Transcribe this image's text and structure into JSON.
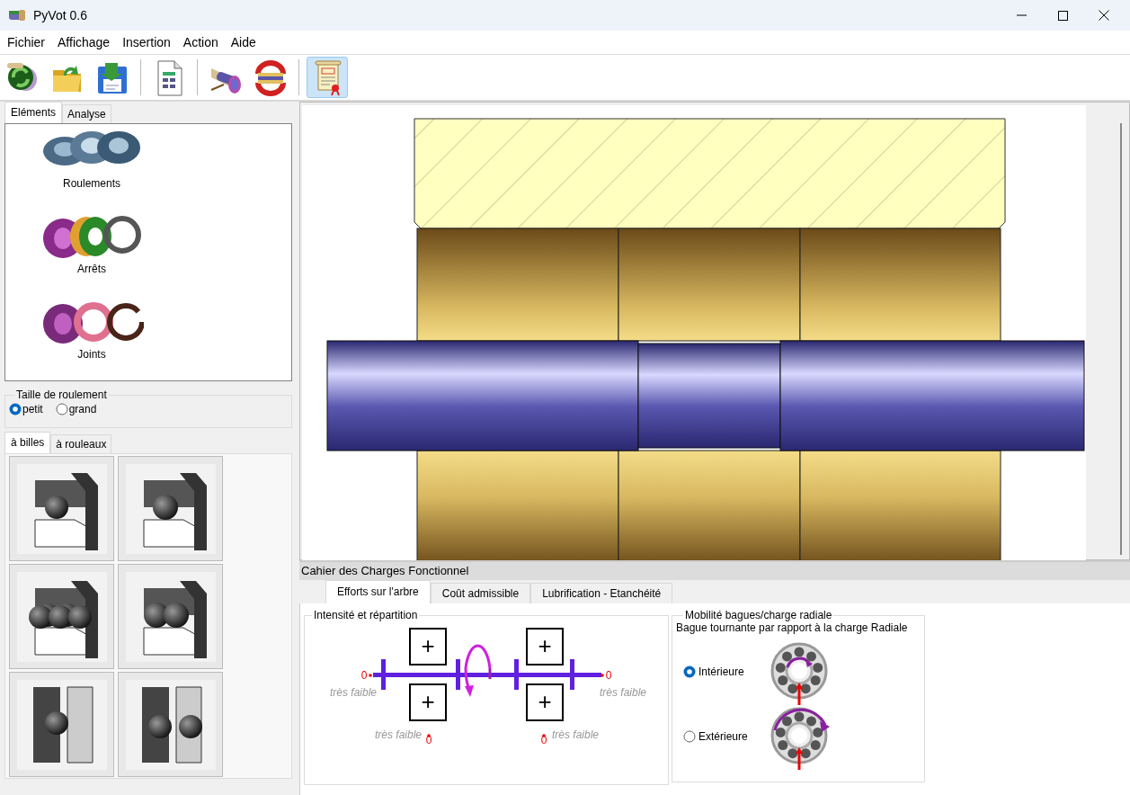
{
  "window": {
    "title": "PyVot 0.6"
  },
  "menu": [
    "Fichier",
    "Affichage",
    "Insertion",
    "Action",
    "Aide"
  ],
  "toolbar": [
    [
      {
        "kind": "new",
        "pressed": false
      },
      {
        "kind": "open",
        "pressed": false
      },
      {
        "kind": "save",
        "pressed": false
      }
    ],
    [
      {
        "kind": "report",
        "pressed": false
      }
    ],
    [
      {
        "kind": "assembly",
        "pressed": false
      },
      {
        "kind": "swap",
        "pressed": false
      }
    ],
    [
      {
        "kind": "cdcf",
        "pressed": true
      }
    ]
  ],
  "left_tabs": [
    {
      "label": "Eléments",
      "selected": true
    },
    {
      "label": "Analyse",
      "selected": false
    }
  ],
  "elements": [
    {
      "label": "Roulements",
      "kind": "bearings"
    },
    {
      "label": "Arrêts",
      "kind": "stops"
    },
    {
      "label": "Joints",
      "kind": "seals"
    }
  ],
  "size_group": {
    "title": "Taille de roulement",
    "options": [
      {
        "label": "petit",
        "selected": true
      },
      {
        "label": "grand",
        "selected": false
      }
    ]
  },
  "bearing_tabs": [
    {
      "label": "à billes",
      "selected": true
    },
    {
      "label": "à rouleaux",
      "selected": false
    }
  ],
  "bearing_types": [
    {
      "kind": "single"
    },
    {
      "kind": "angular"
    },
    {
      "kind": "double"
    },
    {
      "kind": "double-angular"
    },
    {
      "kind": "tall"
    },
    {
      "kind": "tall-double"
    }
  ],
  "cdcf": {
    "title": "Cahier des Charges Fonctionnel",
    "tabs": [
      {
        "label": "Efforts sur l'arbre",
        "selected": true
      },
      {
        "label": "Coût admissible",
        "selected": false
      },
      {
        "label": "Lubrification - Etanchéité",
        "selected": false
      }
    ],
    "loads": {
      "title": "Intensité et répartition",
      "plus_buttons": [
        "+",
        "+",
        "+",
        "+"
      ],
      "axial_left": {
        "value": "0",
        "label": "très faible"
      },
      "axial_right": {
        "value": "0",
        "label": "très faible"
      },
      "radial_left": {
        "value": "0",
        "label": "très faible"
      },
      "radial_right": {
        "value": "0",
        "label": "très faible"
      }
    },
    "mobility": {
      "title": "Mobilité bagues/charge radiale",
      "caption": "Bague tournante par rapport à la charge Radiale",
      "options": [
        {
          "label": "Intérieure",
          "selected": true,
          "kind": "inner"
        },
        {
          "label": "Extérieure",
          "selected": false,
          "kind": "outer"
        }
      ]
    }
  }
}
